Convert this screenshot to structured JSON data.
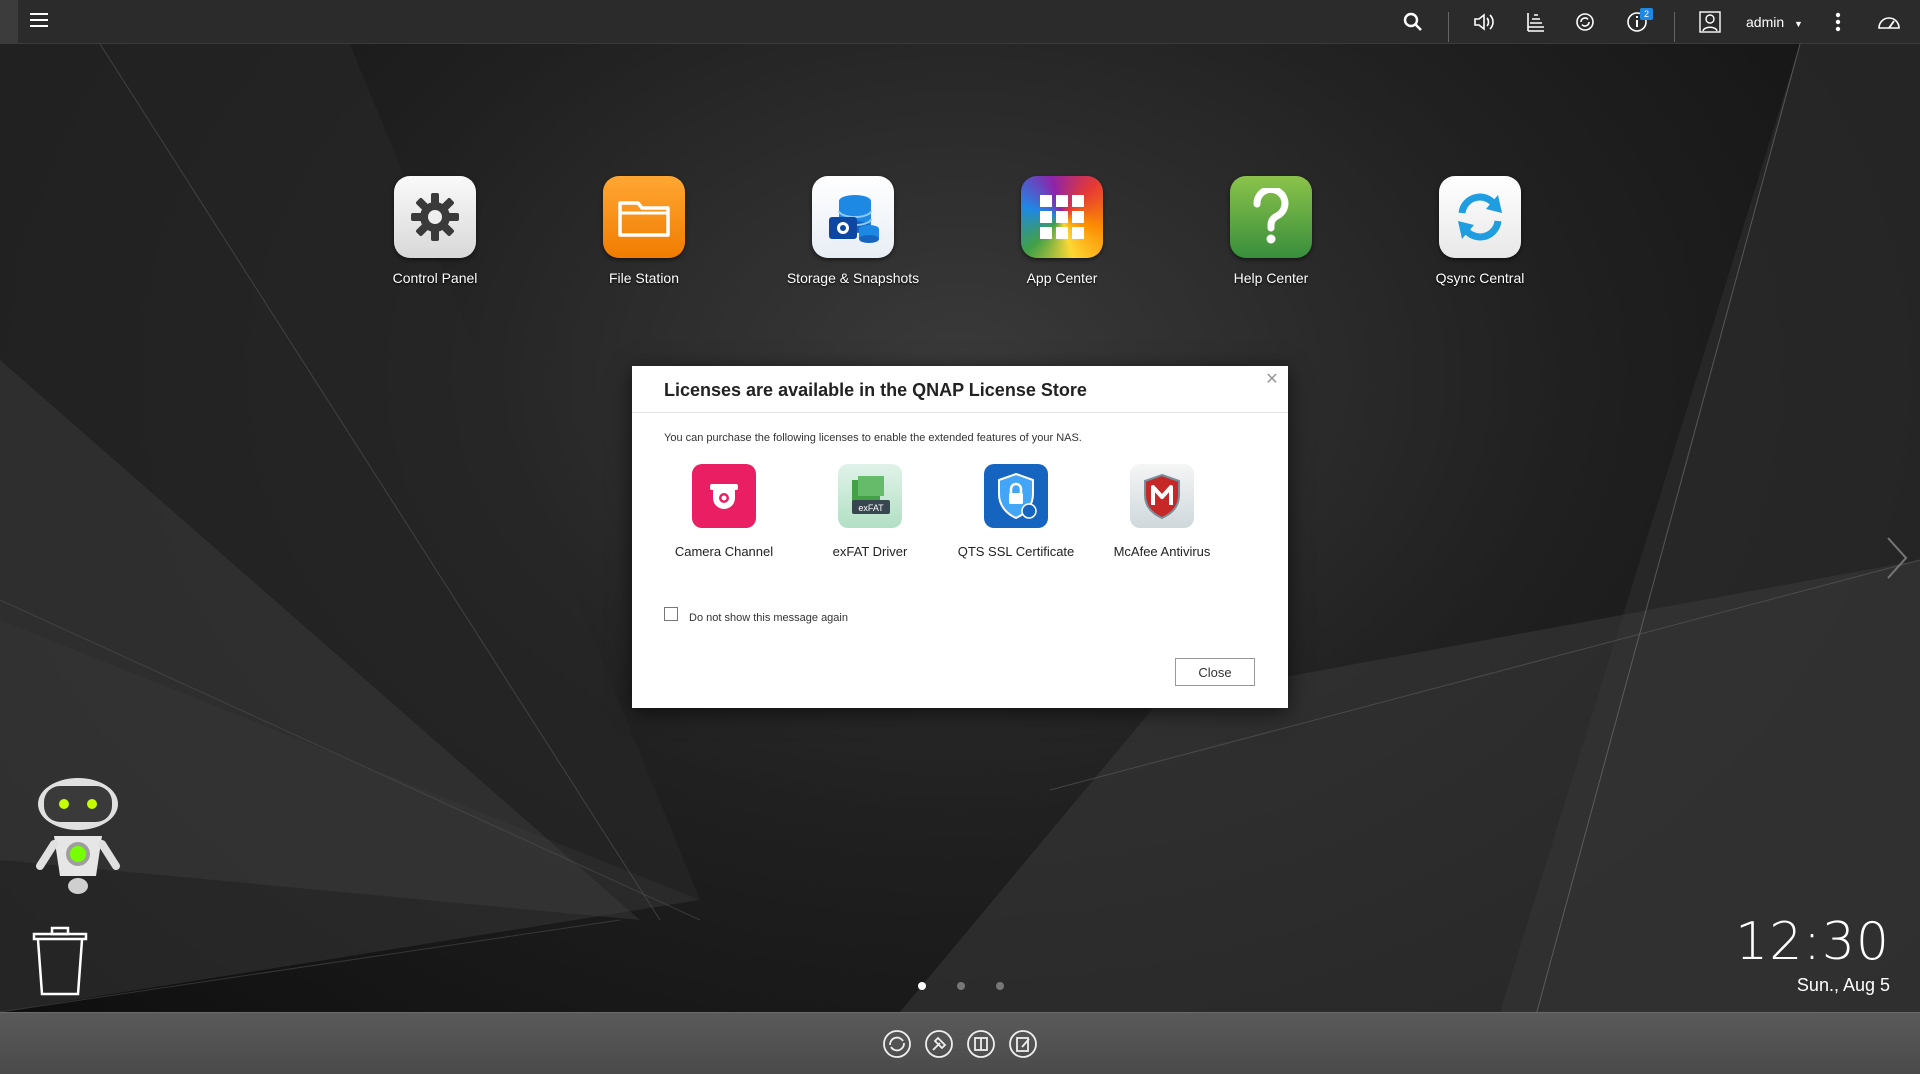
{
  "topbar": {
    "username": "admin",
    "notification_count": "2",
    "icons": [
      "hamburger-icon",
      "search-icon",
      "volume-icon",
      "background-tasks-icon",
      "sync-icon",
      "event-notifications-icon",
      "user-icon",
      "more-icon",
      "dashboard-icon"
    ]
  },
  "desktop": {
    "apps": [
      {
        "label": "Control Panel",
        "icon": "gear-icon"
      },
      {
        "label": "File Station",
        "icon": "folder-icon"
      },
      {
        "label": "Storage & Snapshots",
        "icon": "storage-icon"
      },
      {
        "label": "App Center",
        "icon": "grid-icon"
      },
      {
        "label": "Help Center",
        "icon": "question-icon"
      },
      {
        "label": "Qsync Central",
        "icon": "sync-icon"
      }
    ],
    "clock": "12:30",
    "date": "Sun., Aug 5",
    "page_count": 3,
    "active_page": 1
  },
  "modal": {
    "title": "Licenses are available in the QNAP License Store",
    "description": "You can purchase the following licenses to enable the extended features of your NAS.",
    "licenses": [
      {
        "label": "Camera Channel",
        "icon": "camera-icon",
        "color": "#e91e63"
      },
      {
        "label": "exFAT Driver",
        "icon": "exfat-icon",
        "color": "#4caf50"
      },
      {
        "label": "QTS SSL Certificate",
        "icon": "ssl-shield-icon",
        "color": "#1565c0"
      },
      {
        "label": "McAfee Antivirus",
        "icon": "mcafee-icon",
        "color": "#c62828"
      }
    ],
    "exfat_text": "exFAT",
    "checkbox_label": "Do not show this message again",
    "close_button": "Close"
  },
  "dock": {
    "icons": [
      "qsync-dock-icon",
      "tools-dock-icon",
      "multimedia-dock-icon",
      "notes-dock-icon"
    ]
  }
}
